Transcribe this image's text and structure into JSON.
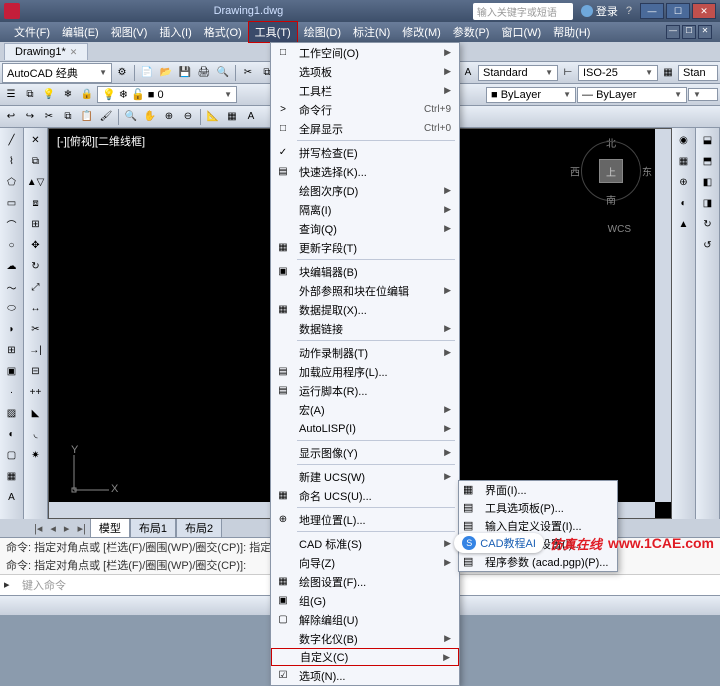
{
  "title": {
    "filename": "Drawing1.dwg",
    "search_placeholder": "输入关键字或短语",
    "login": "登录"
  },
  "menus": [
    "文件(F)",
    "编辑(E)",
    "视图(V)",
    "插入(I)",
    "格式(O)",
    "工具(T)",
    "绘图(D)",
    "标注(N)",
    "修改(M)",
    "参数(P)",
    "窗口(W)",
    "帮助(H)"
  ],
  "tab": {
    "name": "Drawing1*"
  },
  "workspace_combo": "AutoCAD 经典",
  "style_combos": {
    "standard": "Standard",
    "iso25": "ISO-25",
    "stan2": "Stan"
  },
  "layer_combos": {
    "bylayer": "ByLayer",
    "bylayer2": "ByLayer"
  },
  "viewport_label": "[-][俯视][二维线框]",
  "compass": {
    "n": "北",
    "s": "南",
    "e": "东",
    "w": "西",
    "top": "上",
    "wcs": "WCS"
  },
  "tools_menu": [
    {
      "t": "工作空间(O)",
      "arr": true,
      "ico": "□"
    },
    {
      "t": "选项板",
      "arr": true
    },
    {
      "t": "工具栏",
      "arr": true
    },
    {
      "t": "命令行",
      "sc": "Ctrl+9",
      "ico": ">"
    },
    {
      "t": "全屏显示",
      "sc": "Ctrl+0",
      "ico": "□"
    },
    {
      "sep": true
    },
    {
      "t": "拼写检查(E)",
      "ico": "✓"
    },
    {
      "t": "快速选择(K)...",
      "ico": "▤"
    },
    {
      "t": "绘图次序(D)",
      "arr": true
    },
    {
      "t": "隔离(I)",
      "arr": true
    },
    {
      "t": "查询(Q)",
      "arr": true
    },
    {
      "t": "更新字段(T)",
      "ico": "▦"
    },
    {
      "sep": true
    },
    {
      "t": "块编辑器(B)",
      "ico": "▣"
    },
    {
      "t": "外部参照和块在位编辑",
      "arr": true
    },
    {
      "t": "数据提取(X)...",
      "ico": "▦"
    },
    {
      "t": "数据链接",
      "arr": true
    },
    {
      "sep": true
    },
    {
      "t": "动作录制器(T)",
      "arr": true
    },
    {
      "t": "加载应用程序(L)...",
      "ico": "▤"
    },
    {
      "t": "运行脚本(R)...",
      "ico": "▤"
    },
    {
      "t": "宏(A)",
      "arr": true
    },
    {
      "t": "AutoLISP(I)",
      "arr": true
    },
    {
      "sep": true
    },
    {
      "t": "显示图像(Y)",
      "arr": true
    },
    {
      "sep": true
    },
    {
      "t": "新建 UCS(W)",
      "arr": true
    },
    {
      "t": "命名 UCS(U)...",
      "ico": "▦"
    },
    {
      "sep": true
    },
    {
      "t": "地理位置(L)...",
      "ico": "⊕"
    },
    {
      "sep": true
    },
    {
      "t": "CAD 标准(S)",
      "arr": true
    },
    {
      "t": "向导(Z)",
      "arr": true
    },
    {
      "t": "绘图设置(F)...",
      "ico": "▦"
    },
    {
      "t": "组(G)",
      "ico": "▣"
    },
    {
      "t": "解除编组(U)",
      "ico": "▢"
    },
    {
      "t": "数字化仪(B)",
      "arr": true
    },
    {
      "t": "自定义(C)",
      "arr": true,
      "hl": true
    },
    {
      "t": "选项(N)...",
      "ico": "☑"
    }
  ],
  "submenu": [
    {
      "t": "界面(I)...",
      "ico": "▦"
    },
    {
      "t": "工具选项板(P)...",
      "ico": "▤"
    },
    {
      "sep": true
    },
    {
      "t": "输入自定义设置(I)...",
      "ico": "▤"
    },
    {
      "t": "输出自定义设置(I)...",
      "ico": "▤"
    },
    {
      "t": "程序参数 (acad.pgp)(P)...",
      "ico": "▤",
      "hl": true
    }
  ],
  "layouts": {
    "model": "模型",
    "l1": "布局1",
    "l2": "布局2"
  },
  "cmd": {
    "l1": "命令: 指定对角点或 [栏选(F)/圈围(WP)/圈交(CP)]: 指定对角点或 [栏选(F)/圈围(WP)/圈交(CP)]:",
    "l2": "命令: 指定对角点或 [栏选(F)/圈围(WP)/圈交(CP)]:",
    "prompt": "键入命令"
  },
  "watermark": {
    "brand": "CAD教程AI",
    "cn": "仿真在线",
    "url": "www.1CAE.com"
  }
}
